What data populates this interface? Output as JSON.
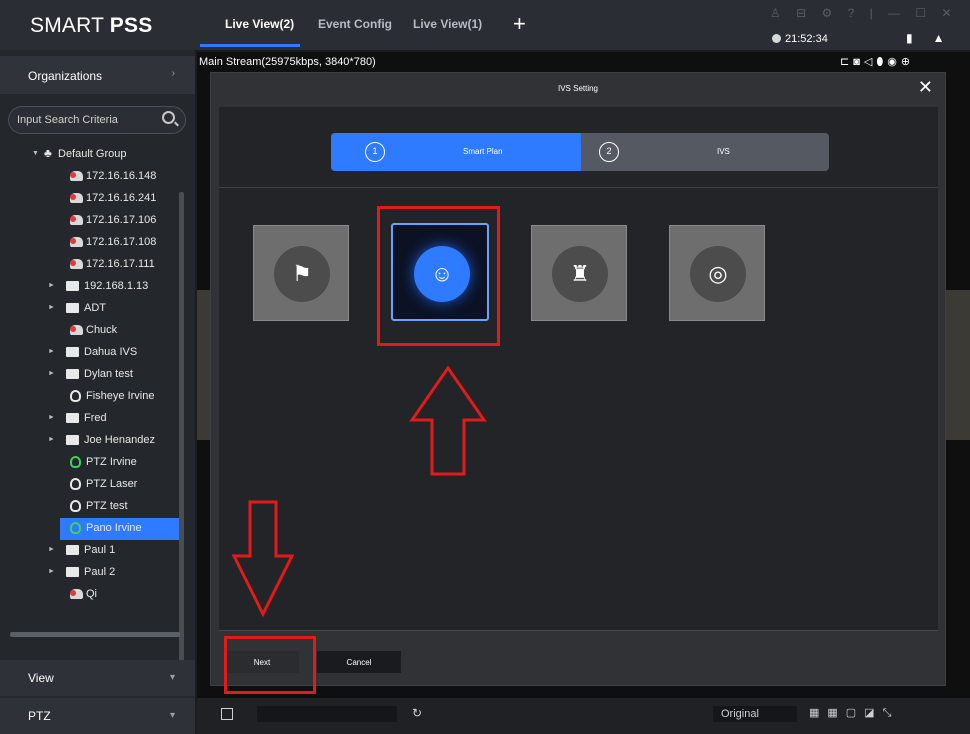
{
  "app": {
    "logo_light": "SMART ",
    "logo_bold": "PSS",
    "tabs": [
      {
        "label": "Live View(2)",
        "active": true
      },
      {
        "label": "Event Config",
        "active": false
      },
      {
        "label": "Live View(1)",
        "active": false
      }
    ],
    "add_tab": "+",
    "time": "21:52:34"
  },
  "sidebar": {
    "organizations": "Organizations",
    "search_placeholder": "Input Search Criteria",
    "tree": [
      {
        "label": "Default Group",
        "icon": "org-icon",
        "expand": "down"
      },
      {
        "label": "172.16.16.148",
        "icon": "camera-icon"
      },
      {
        "label": "172.16.16.241",
        "icon": "camera-icon"
      },
      {
        "label": "172.16.17.106",
        "icon": "camera-icon"
      },
      {
        "label": "172.16.17.108",
        "icon": "camera-icon"
      },
      {
        "label": "172.16.17.111",
        "icon": "camera-icon"
      },
      {
        "label": "192.168.1.13",
        "icon": "device-icon"
      },
      {
        "label": "ADT",
        "icon": "nvr-icon"
      },
      {
        "label": "Chuck",
        "icon": "camera-icon"
      },
      {
        "label": "Dahua IVS",
        "icon": "nvr-icon"
      },
      {
        "label": "Dylan test",
        "icon": "nvr-icon"
      },
      {
        "label": "Fisheye Irvine",
        "icon": "ptz-icon"
      },
      {
        "label": "Fred",
        "icon": "nvr-icon"
      },
      {
        "label": "Joe Henandez",
        "icon": "nvr-icon"
      },
      {
        "label": "PTZ Irvine",
        "icon": "ptz-icon"
      },
      {
        "label": "PTZ Laser",
        "icon": "ptz-icon"
      },
      {
        "label": "PTZ test",
        "icon": "ptz-icon"
      },
      {
        "label": "Pano Irvine",
        "icon": "ptz-icon",
        "selected": true
      },
      {
        "label": "Paul 1",
        "icon": "nvr-icon"
      },
      {
        "label": "Paul 2",
        "icon": "nvr-icon"
      },
      {
        "label": "Qi",
        "icon": "camera-icon"
      }
    ],
    "view": "View",
    "ptz": "PTZ"
  },
  "live": {
    "stream_info": "Main Stream(25975kbps, 3840*780)",
    "original": "Original"
  },
  "modal": {
    "title": "IVS Setting",
    "steps": [
      {
        "num": "1",
        "label": "Smart Plan"
      },
      {
        "num": "2",
        "label": "IVS"
      }
    ],
    "plans": [
      {
        "icon": "people-walking-icon",
        "selected": false
      },
      {
        "icon": "face-detection-icon",
        "selected": true
      },
      {
        "icon": "people-counting-icon",
        "selected": false
      },
      {
        "icon": "heat-map-icon",
        "selected": false
      }
    ],
    "next": "Next",
    "cancel": "Cancel"
  },
  "colors": {
    "accent": "#2f7bff",
    "highlight": "#e11a1a"
  }
}
